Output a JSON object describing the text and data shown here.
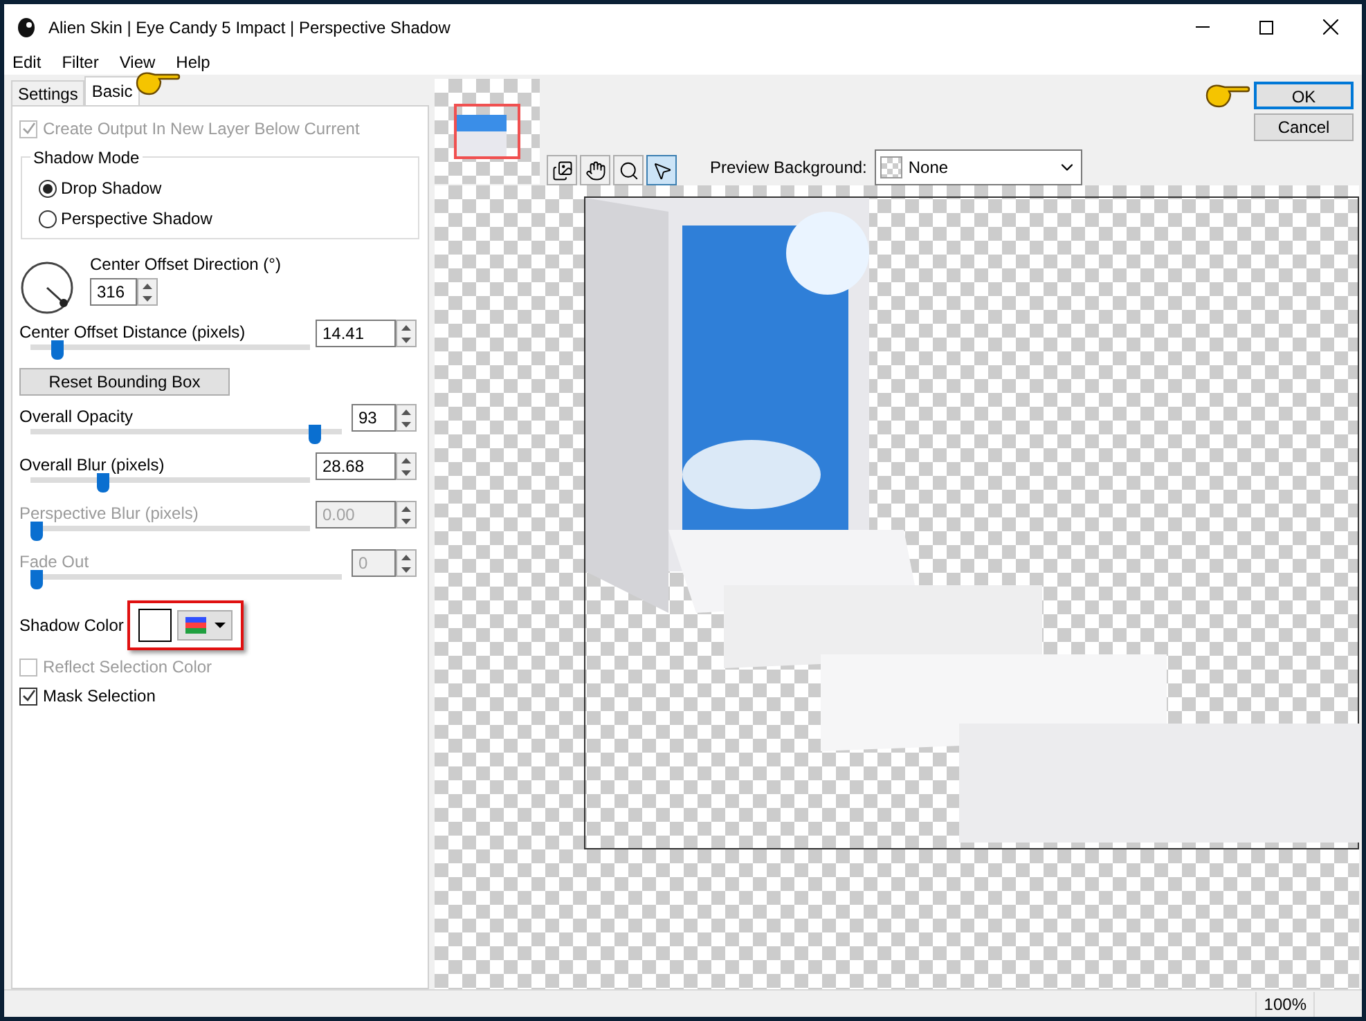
{
  "window": {
    "title": "Alien Skin | Eye Candy 5 Impact | Perspective Shadow"
  },
  "menu": [
    "Edit",
    "Filter",
    "View",
    "Help"
  ],
  "tabs": [
    {
      "label": "Settings",
      "selected": false
    },
    {
      "label": "Basic",
      "selected": true
    }
  ],
  "create_output": {
    "label": "Create Output In New Layer Below Current",
    "checked": true,
    "disabled": true
  },
  "shadow_mode": {
    "title": "Shadow Mode",
    "options": [
      {
        "label": "Drop Shadow",
        "selected": true
      },
      {
        "label": "Perspective Shadow",
        "selected": false
      }
    ]
  },
  "direction": {
    "label": "Center Offset Direction (°)",
    "value": "316"
  },
  "controls": [
    {
      "kind": "slider",
      "label": "Center Offset Distance (pixels)",
      "value": "14.41",
      "level": 0.08,
      "disabled": false,
      "wide": false
    },
    {
      "kind": "button",
      "label": "Reset Bounding Box"
    },
    {
      "kind": "slider",
      "label": "Overall Opacity",
      "value": "93",
      "level": 0.93,
      "disabled": false,
      "wide": true
    },
    {
      "kind": "slider",
      "label": "Overall Blur (pixels)",
      "value": "28.68",
      "level": 0.25,
      "disabled": false,
      "wide": false
    },
    {
      "kind": "slider",
      "label": "Perspective Blur (pixels)",
      "value": "0.00",
      "level": 0,
      "disabled": true,
      "wide": false
    },
    {
      "kind": "slider",
      "label": "Fade Out",
      "value": "0",
      "level": 0,
      "disabled": true,
      "wide": true
    }
  ],
  "shadow_color": {
    "label": "Shadow Color",
    "color": "#ffffff"
  },
  "checkboxes": [
    {
      "label": "Reflect Selection Color",
      "checked": false,
      "disabled": true
    },
    {
      "label": "Mask Selection",
      "checked": true,
      "disabled": false
    }
  ],
  "buttons": [
    "OK",
    "Cancel"
  ],
  "tools": [
    {
      "kind": "preview",
      "selected": false
    },
    {
      "kind": "hand",
      "selected": false
    },
    {
      "kind": "zoom",
      "selected": false
    },
    {
      "kind": "pointer",
      "selected": true
    }
  ],
  "preview_background": {
    "label": "Preview Background:",
    "value": "None"
  },
  "status_bar": {
    "zoom": "100%"
  }
}
